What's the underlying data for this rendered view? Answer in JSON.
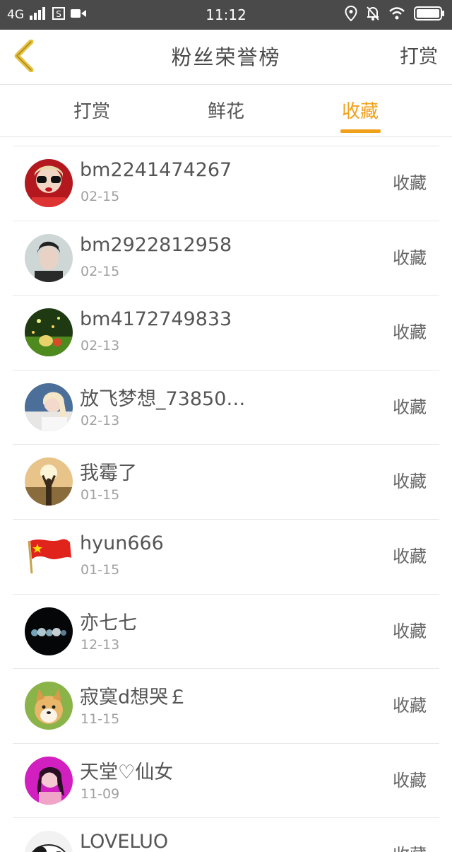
{
  "status_bar": {
    "network": "4G",
    "time": "11:12"
  },
  "header": {
    "title": "粉丝荣誉榜",
    "action": "打赏"
  },
  "tabs": [
    {
      "label": "打赏",
      "active": false
    },
    {
      "label": "鲜花",
      "active": false
    },
    {
      "label": "收藏",
      "active": true
    }
  ],
  "accent_color": "#f0a11a",
  "list": [
    {
      "name": "bm2241474267",
      "date": "02-15",
      "type": "收藏"
    },
    {
      "name": "bm2922812958",
      "date": "02-15",
      "type": "收藏"
    },
    {
      "name": "bm4172749833",
      "date": "02-13",
      "type": "收藏"
    },
    {
      "name": "放飞梦想_73850…",
      "date": "02-13",
      "type": "收藏"
    },
    {
      "name": "我霉了",
      "date": "01-15",
      "type": "收藏"
    },
    {
      "name": "hyun666",
      "date": "01-15",
      "type": "收藏"
    },
    {
      "name": "亦七七",
      "date": "12-13",
      "type": "收藏"
    },
    {
      "name": "寂寞d想哭￡",
      "date": "11-15",
      "type": "收藏"
    },
    {
      "name": "天堂♡仙女",
      "date": "11-09",
      "type": "收藏"
    },
    {
      "name": "LOVELUO",
      "date": "",
      "type": "收藏"
    }
  ]
}
